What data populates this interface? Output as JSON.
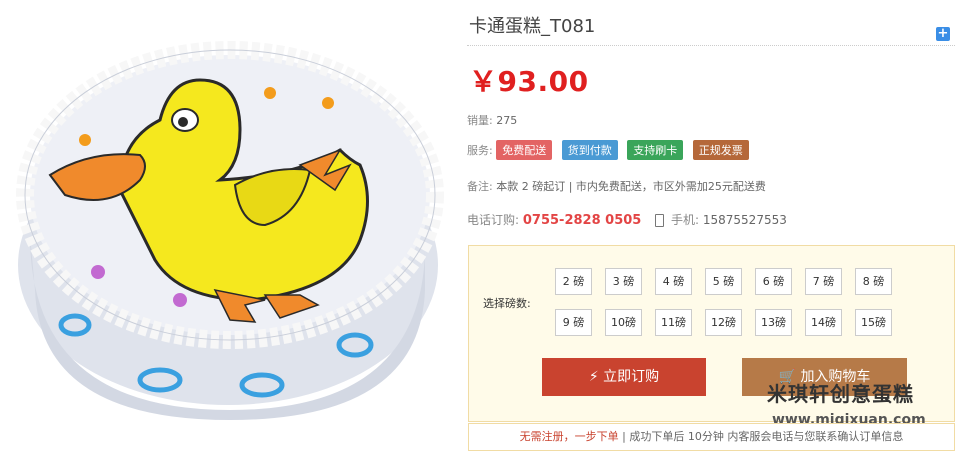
{
  "product": {
    "title": "卡通蛋糕_T081",
    "price": "￥93.00",
    "sales_label": "销量:",
    "sales_value": "275",
    "service_label": "服务:",
    "services": [
      "免费配送",
      "货到付款",
      "支持刷卡",
      "正规发票"
    ],
    "note_label": "备注:",
    "note_text": "本款 2 磅起订 | 市内免费配送，市区外需加25元配送费",
    "phone_label": "电话订购:",
    "phone_value": "0755-2828 0505",
    "mobile_label": "手机:",
    "mobile_value": "15875527553"
  },
  "size_select": {
    "label": "选择磅数:",
    "options": [
      "2 磅",
      "3 磅",
      "4 磅",
      "5 磅",
      "6 磅",
      "7 磅",
      "8 磅",
      "9 磅",
      "10磅",
      "11磅",
      "12磅",
      "13磅",
      "14磅",
      "15磅"
    ]
  },
  "actions": {
    "order_label": "立即订购",
    "cart_label": "加入购物车"
  },
  "watermark": {
    "brand": "米琪轩创意蛋糕",
    "url": "www.miqixuan.com"
  },
  "notice": {
    "highlight": "无需注册，一步下单",
    "text": " | 成功下单后 10分钟 内客服会电话与您联系确认订单信息"
  },
  "colors": {
    "price": "#e02020",
    "order_button": "#c9432f",
    "cart_button": "#b67a48"
  }
}
